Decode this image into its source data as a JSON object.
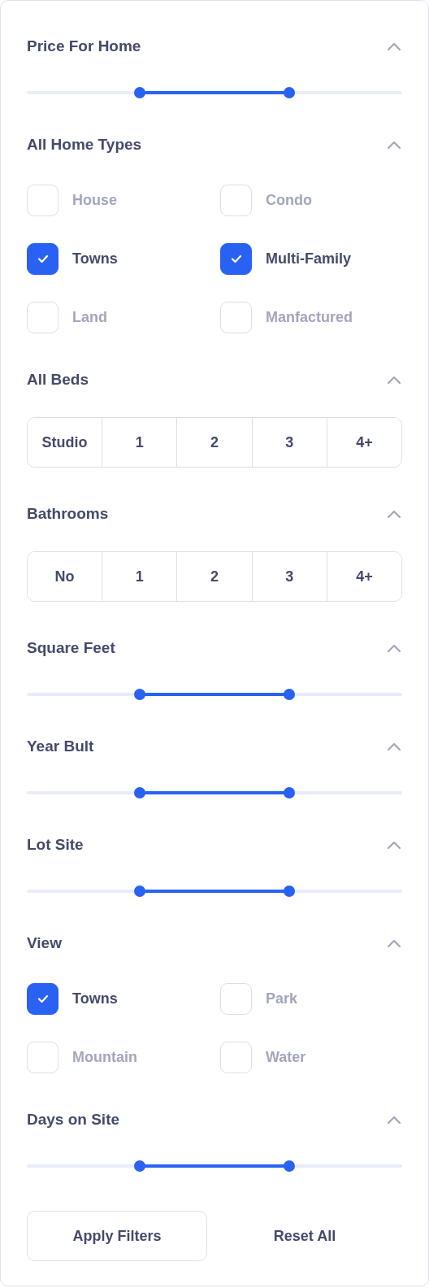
{
  "sections": [
    {
      "kind": "range",
      "title": "Price For Home",
      "expanded": true,
      "thumbs": [
        {
          "level": 0.3
        },
        {
          "level": 0.7
        }
      ]
    },
    {
      "kind": "checkboxes",
      "title": "All Home Types",
      "expanded": true,
      "options": [
        {
          "label": "House",
          "checked": false
        },
        {
          "label": "Condo",
          "checked": false
        },
        {
          "label": "Towns",
          "checked": true
        },
        {
          "label": "Multi-Family",
          "checked": true
        },
        {
          "label": "Land",
          "checked": false
        },
        {
          "label": "Manfactured",
          "checked": false
        }
      ]
    },
    {
      "kind": "segmented",
      "title": "All Beds",
      "expanded": true,
      "options": [
        "Studio",
        "1",
        "2",
        "3",
        "4+"
      ]
    },
    {
      "kind": "segmented",
      "title": "Bathrooms",
      "expanded": true,
      "options": [
        "No",
        "1",
        "2",
        "3",
        "4+"
      ]
    },
    {
      "kind": "range",
      "title": "Square Feet",
      "expanded": true,
      "thumbs": [
        {
          "level": 0.3
        },
        {
          "level": 0.7
        }
      ]
    },
    {
      "kind": "range",
      "title": "Year Bult",
      "expanded": true,
      "thumbs": [
        {
          "level": 0.3
        },
        {
          "level": 0.7
        }
      ]
    },
    {
      "kind": "range",
      "title": "Lot Site",
      "expanded": true,
      "thumbs": [
        {
          "level": 0.3
        },
        {
          "level": 0.7
        }
      ]
    },
    {
      "kind": "checkboxes",
      "title": "View",
      "expanded": true,
      "options": [
        {
          "label": "Towns",
          "checked": true
        },
        {
          "label": "Park",
          "checked": false
        },
        {
          "label": "Mountain",
          "checked": false
        },
        {
          "label": "Water",
          "checked": false
        }
      ]
    },
    {
      "kind": "range",
      "title": "Days on Site",
      "expanded": true,
      "thumbs": [
        {
          "level": 0.3
        },
        {
          "level": 0.7
        }
      ]
    }
  ],
  "buttons": {
    "apply": "Apply Filters",
    "reset": "Reset All"
  }
}
